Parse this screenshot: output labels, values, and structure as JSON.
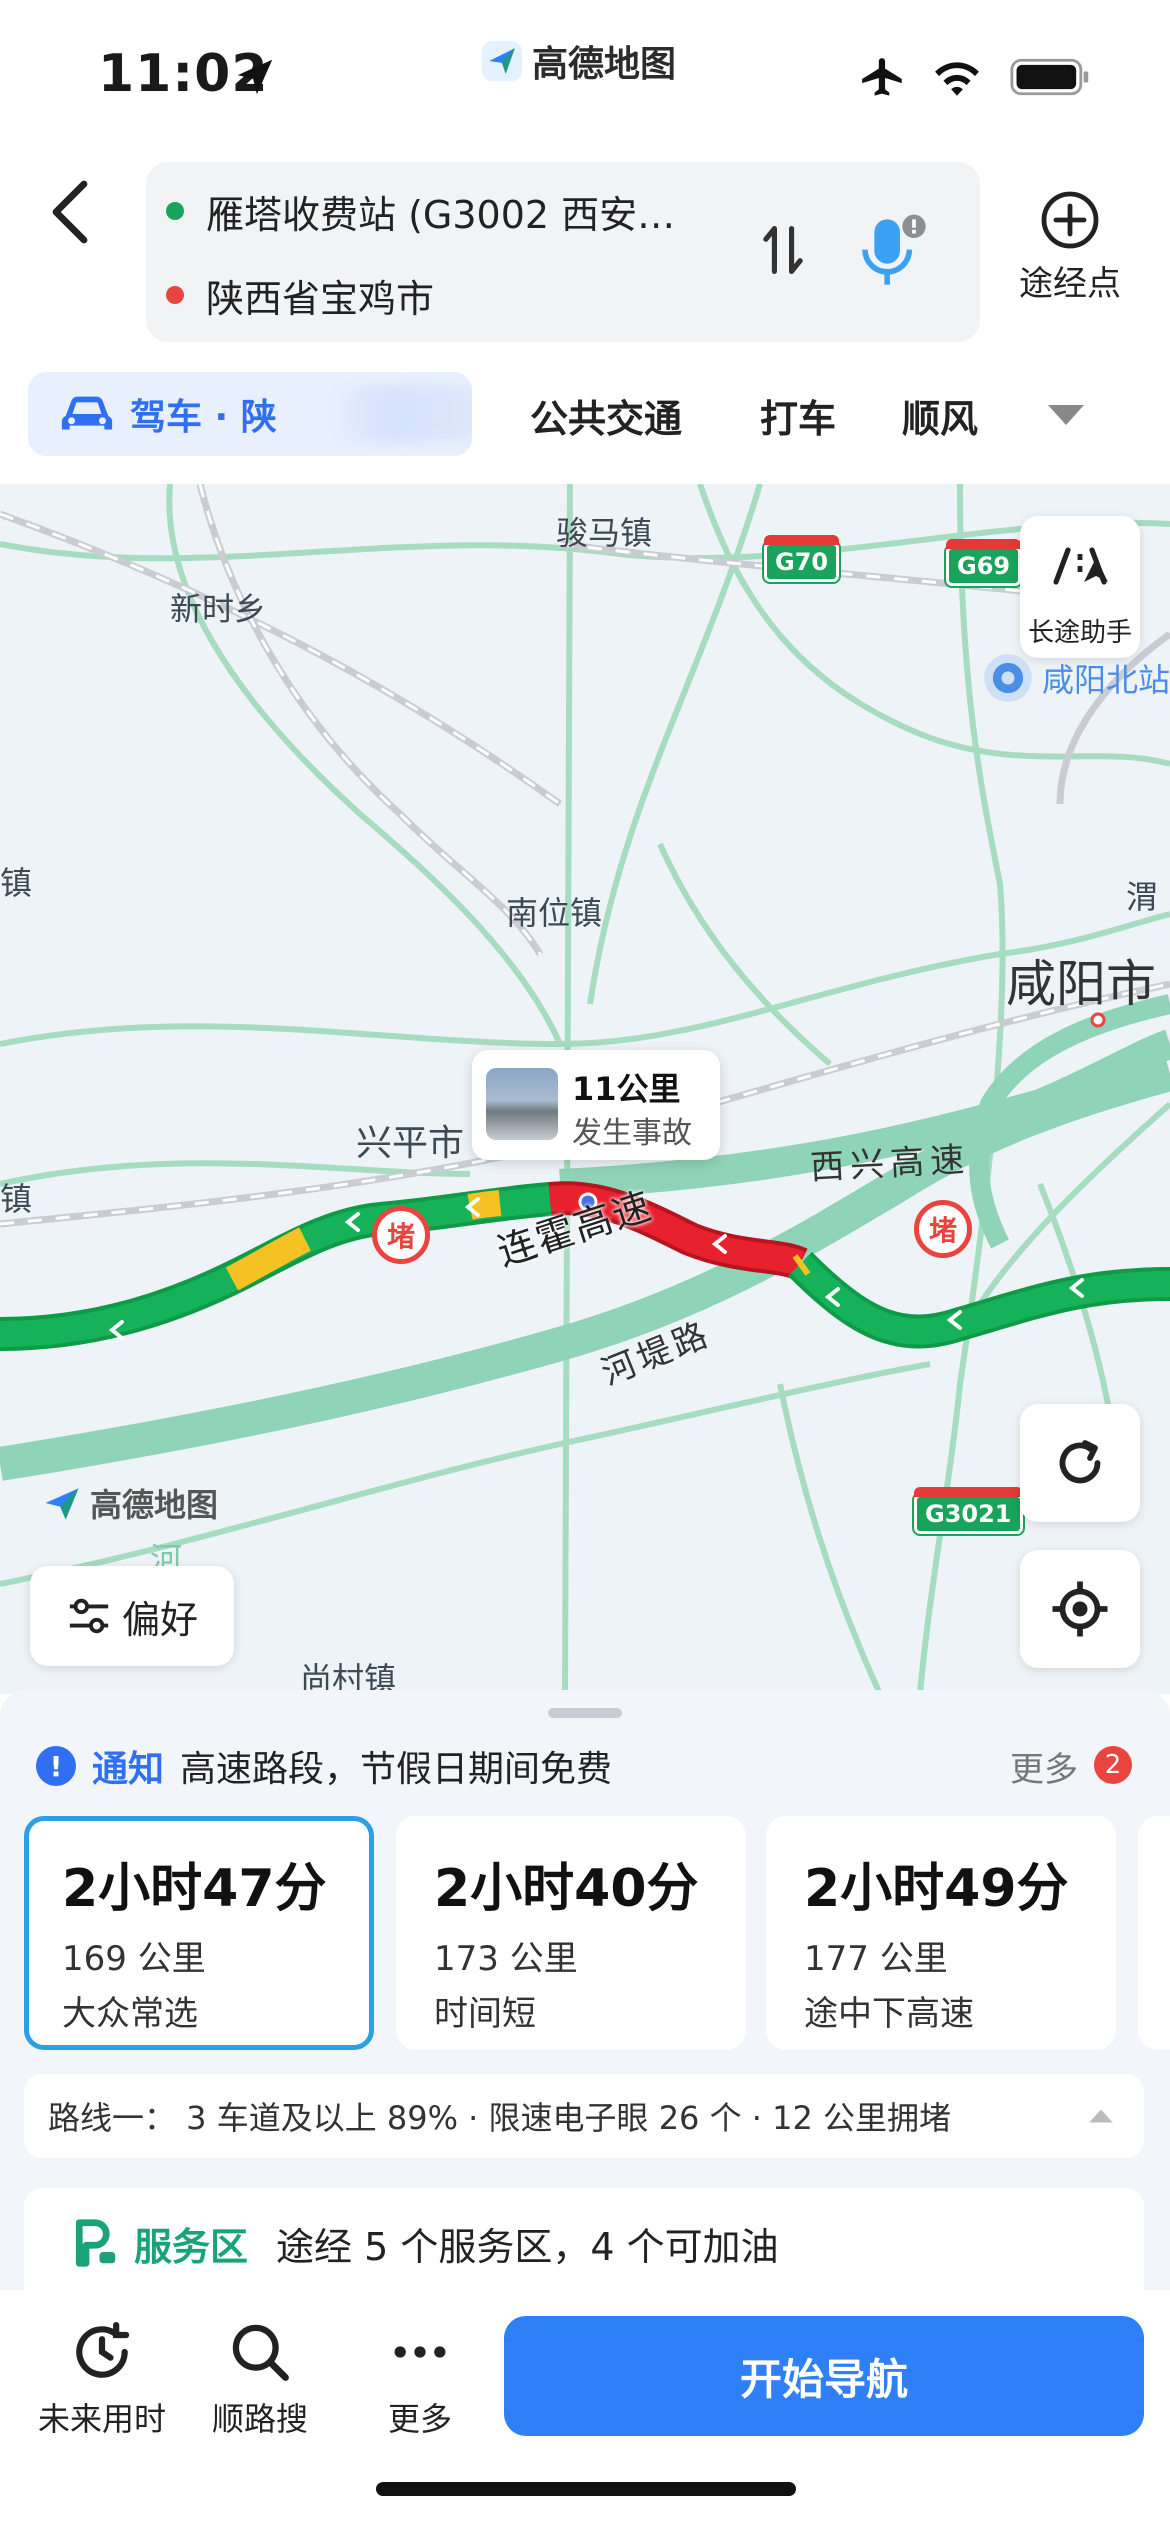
{
  "status_bar": {
    "time": "11:02",
    "app_name": "高德地图"
  },
  "route": {
    "origin": "雁塔收费站 (G3002 西安…",
    "destination": "陕西省宝鸡市",
    "origin_color": "#1aa35a",
    "destination_color": "#e9443e",
    "via_label": "途经点"
  },
  "modes": {
    "drive": "驾车 · 陕",
    "transit": "公共交通",
    "taxi": "打车",
    "carpool": "顺风"
  },
  "map": {
    "labels": {
      "junma": "骏马镇",
      "xinshi": "新时乡",
      "nanwei": "南位镇",
      "xianyang": "咸阳市",
      "xingping": "兴平市",
      "wei": "渭",
      "zhen_left1": "镇",
      "zhen_left2": "镇",
      "xianyang_north": "咸阳北站",
      "shangcun": "尚村镇",
      "he": "河"
    },
    "road_names": {
      "lianhuo": "连霍高速",
      "xixing": "西兴高速",
      "hedi": "河堤路"
    },
    "shields": {
      "g70": "G70",
      "g69": "G69",
      "g3021": "G3021"
    },
    "jam_label": "堵",
    "incident": {
      "distance": "11公里",
      "desc": "发生事故"
    },
    "watermark": "高德地图",
    "assistant_label": "长途助手",
    "preference_label": "偏好",
    "traffic_colors": {
      "smooth": "#16b25a",
      "slow": "#f5c223",
      "jam": "#e8212f"
    }
  },
  "notice": {
    "label": "通知",
    "text": "高速路段，节假日期间免费",
    "more": "更多",
    "count": "2"
  },
  "routes": [
    {
      "duration": "2小时47分",
      "distance": "169 公里",
      "tag": "大众常选"
    },
    {
      "duration": "2小时40分",
      "distance": "173 公里",
      "tag": "时间短"
    },
    {
      "duration": "2小时49分",
      "distance": "177 公里",
      "tag": "途中下高速"
    }
  ],
  "route_info": "路线一： 3 车道及以上 89% · 限速电子眼 26 个 · 12 公里拥堵",
  "service_area": {
    "label": "服务区",
    "text": "途经 5 个服务区，4 个可加油"
  },
  "bottom_bar": {
    "future": "未来用时",
    "along": "顺路搜",
    "more": "更多",
    "start_nav": "开始导航"
  }
}
